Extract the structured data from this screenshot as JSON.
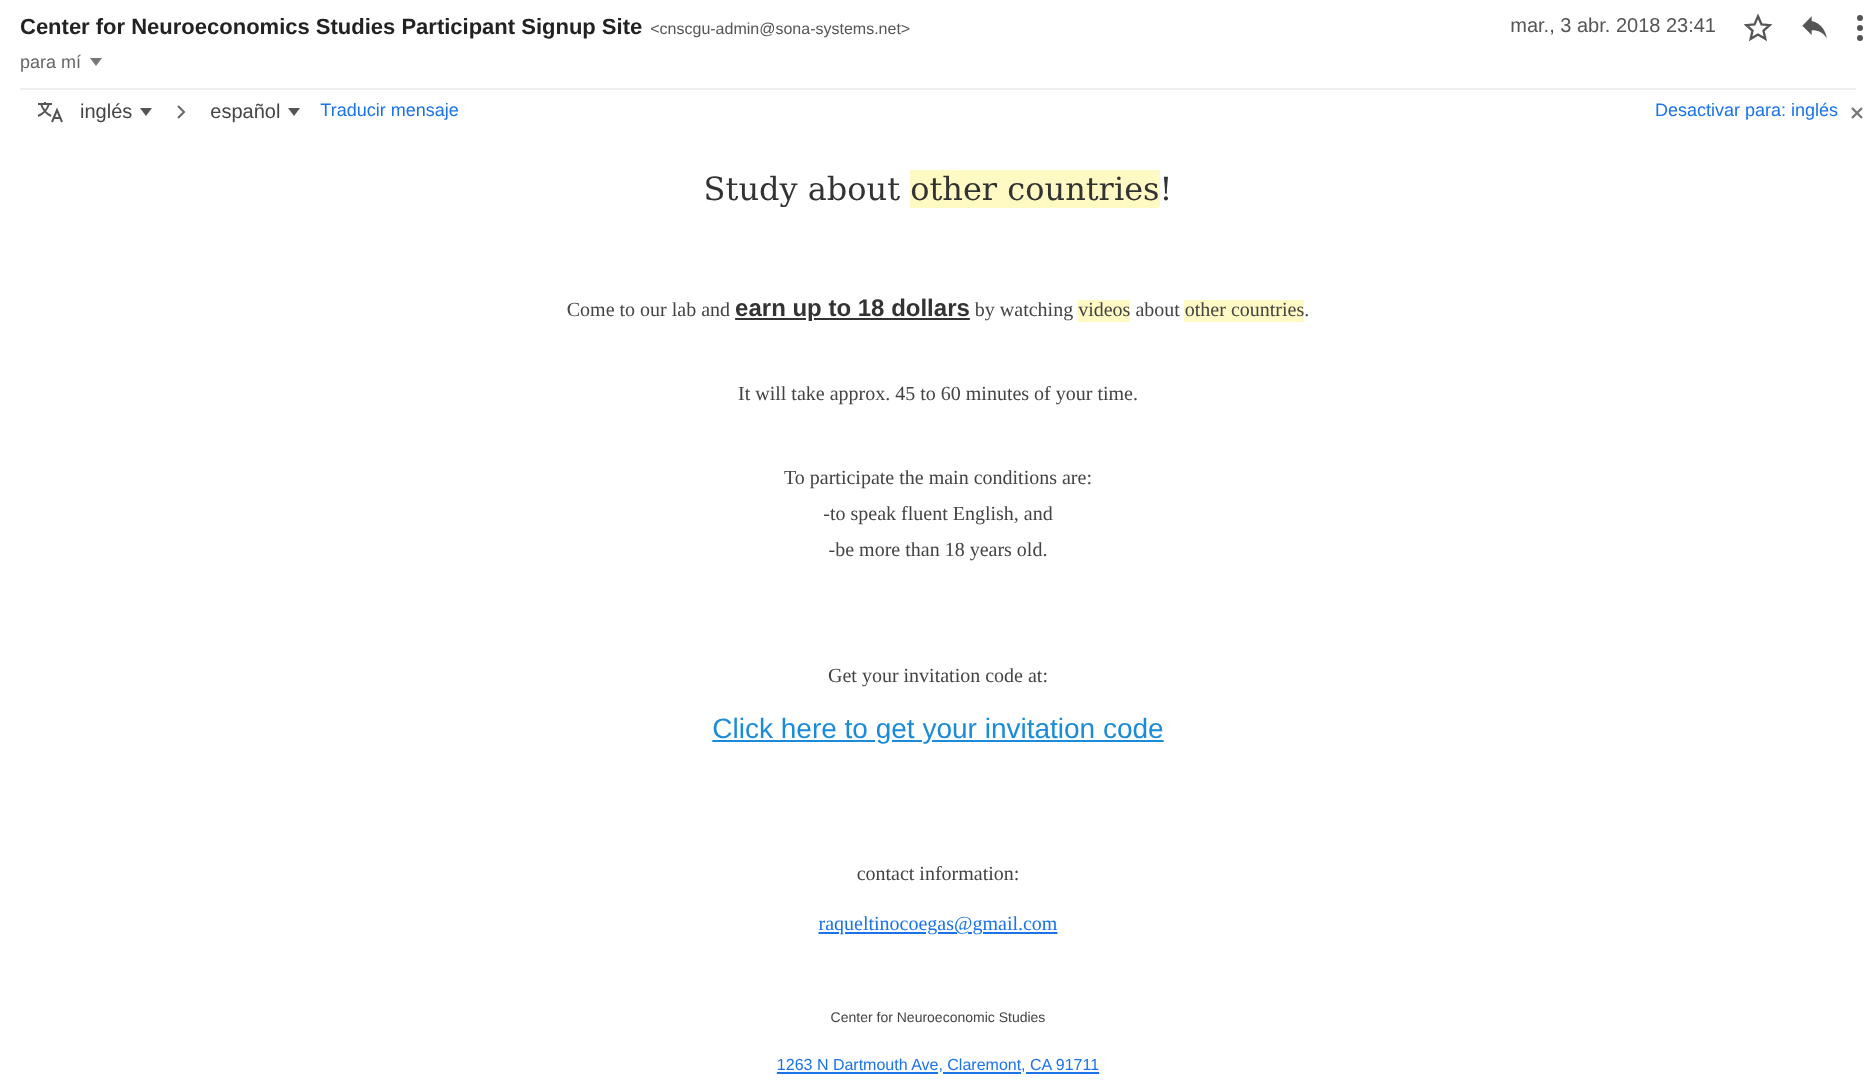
{
  "email": {
    "sender": "Center for Neuroeconomics Studies Participant Signup Site",
    "sender_address": "<cnscgu-admin@sona-systems.net>",
    "recipient": "para mí",
    "date": "mar., 3 abr. 2018 23:41"
  },
  "translate_bar": {
    "source_language": "inglés",
    "target_language": "español",
    "translate_link": "Traducir mensaje",
    "disable_link": "Desactivar para: inglés"
  },
  "body": [
    {
      "kind": "title",
      "segments": [
        {
          "text": "Study about ",
          "kind": "plain"
        },
        {
          "text": "other countries",
          "kind": "highlight"
        },
        {
          "text": "!",
          "kind": "plain"
        }
      ]
    },
    {
      "kind": "text",
      "segments": [
        {
          "text": "Come to our lab and ",
          "kind": "plain"
        },
        {
          "text": "earn up to 18 dollars",
          "kind": "strong"
        },
        {
          "text": " by watching ",
          "kind": "plain"
        },
        {
          "text": "videos",
          "kind": "highlight"
        },
        {
          "text": " about ",
          "kind": "plain"
        },
        {
          "text": "other countries",
          "kind": "highlight"
        },
        {
          "text": ".",
          "kind": "plain"
        }
      ]
    },
    {
      "kind": "text",
      "segments": [
        {
          "text": "It will take approx. 45 to 60 minutes of your time.",
          "kind": "plain"
        }
      ]
    },
    {
      "kind": "text",
      "segments": [
        {
          "text": "To participate the main conditions are:",
          "kind": "plain"
        }
      ]
    },
    {
      "kind": "text",
      "segments": [
        {
          "text": "-to speak fluent English, and",
          "kind": "plain"
        }
      ]
    },
    {
      "kind": "text",
      "segments": [
        {
          "text": "-be more than 18 years old.",
          "kind": "plain"
        }
      ]
    },
    {
      "kind": "text",
      "segments": [
        {
          "text": "Get your invitation code at:",
          "kind": "plain"
        }
      ]
    },
    {
      "kind": "big_link",
      "text": "Click here to get your invitation code"
    },
    {
      "kind": "text",
      "segments": [
        {
          "text": "contact information:",
          "kind": "plain"
        }
      ]
    },
    {
      "kind": "link",
      "text": "raqueltinocoegas@gmail.com"
    },
    {
      "kind": "small",
      "text": "Center for Neuroeconomic Studies"
    },
    {
      "kind": "small_link",
      "text": "1263 N Dartmouth Ave, Claremont, CA 91711"
    }
  ]
}
